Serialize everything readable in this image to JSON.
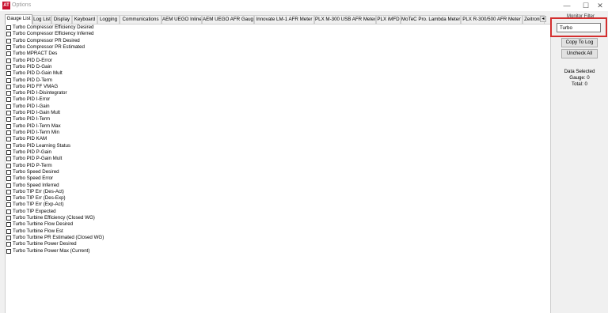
{
  "window": {
    "app_icon_text": "AT",
    "title": "Options",
    "minimize_glyph": "—",
    "maximize_glyph": "☐",
    "close_glyph": "✕"
  },
  "tabs": [
    {
      "label": "Gauge List",
      "active": true
    },
    {
      "label": "Log List"
    },
    {
      "label": "Display"
    },
    {
      "label": "Keyboard"
    },
    {
      "label": "Logging"
    },
    {
      "label": "Communications"
    },
    {
      "label": "AEM UEGO Inline"
    },
    {
      "label": "AEM UEGO AFR Gauge"
    },
    {
      "label": "Innovate LM-1 AFR Meter"
    },
    {
      "label": "PLX M-300 USB AFR Meter"
    },
    {
      "label": "PLX iMFD"
    },
    {
      "label": "MoTeC Pro. Lambda Meter"
    },
    {
      "label": "PLX R-300/500 AFR Meter"
    },
    {
      "label": "Zeitronix"
    }
  ],
  "tab_scroll_glyph": "◂",
  "gauge_items": [
    "Turbo Compressor Efficiency Desired",
    "Turbo Compressor Efficiency Inferred",
    "Turbo Compressor PR Desired",
    "Turbo Compressor PR Estimated",
    "Turbo MPRACT Des",
    "Turbo PID D-Error",
    "Turbo PID D-Gain",
    "Turbo PID D-Gain Mult",
    "Turbo PID D-Term",
    "Turbo PID FF VMAG",
    "Turbo PID I-Disintegrator",
    "Turbo PID I-Error",
    "Turbo PID I-Gain",
    "Turbo PID I-Gain Mult",
    "Turbo PID I-Term",
    "Turbo PID I-Term Max",
    "Turbo PID I-Term Min",
    "Turbo PID KAM",
    "Turbo PID Learning Status",
    "Turbo PID P-Gain",
    "Turbo PID P-Gain Mult",
    "Turbo PID P-Term",
    "Turbo Speed Desired",
    "Turbo Speed Error",
    "Turbo Speed Inferred",
    "Turbo TIP Err (Des-Act)",
    "Turbo TIP Err (Des-Exp)",
    "Turbo TIP Err (Exp-Act)",
    "Turbo TIP Expected",
    "Turbo Turbine Efficiency (Closed WG)",
    "Turbo Turbine Flow Desired",
    "Turbo Turbine Flow Est",
    "Turbo Turbine PR Estimated (Closed WG)",
    "Turbo Turbine Power Desired",
    "Turbo Turbine Power Max (Current)"
  ],
  "sidebar": {
    "filter_label": "Monitor Filter",
    "filter_value": "Turbo",
    "copy_to_log_label": "Copy To Log",
    "uncheck_all_label": "Uncheck All",
    "data_selected_label": "Data Selected",
    "gauge_count_text": "Gauge: 0",
    "total_count_text": "Total: 0"
  },
  "colors": {
    "highlight_border": "#d32f2f",
    "app_icon": "#c8102e"
  }
}
